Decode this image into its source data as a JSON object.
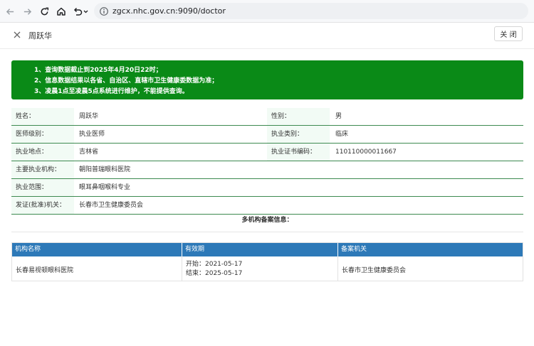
{
  "browser": {
    "url": "zgcx.nhc.gov.cn:9090/doctor"
  },
  "dialog": {
    "title": "周跃华",
    "close_label": "关 闭"
  },
  "notice": {
    "lines": [
      "1、查询数据截止到2025年4月20日22时；",
      "2、信息数据结果以各省、自治区、直辖市卫生健康委数据为准；",
      "3、凌晨1点至凌晨5点系统进行维护，不能提供查询。"
    ]
  },
  "info": {
    "rows": [
      {
        "label": "姓名：",
        "value": "周跃华",
        "label2": "性别：",
        "value2": "男"
      },
      {
        "label": "医师级别：",
        "value": "执业医师",
        "label2": "执业类别：",
        "value2": "临床"
      },
      {
        "label": "执业地点：",
        "value": "吉林省",
        "label2": "执业证书编码：",
        "value2": "110110000011667"
      },
      {
        "label": "主要执业机构：",
        "value": "朝阳普瑞眼科医院",
        "label2": "",
        "value2": ""
      },
      {
        "label": "执业范围：",
        "value": "眼耳鼻咽喉科专业",
        "label2": "",
        "value2": ""
      },
      {
        "label": "发证(批准)机关：",
        "value": "长春市卫生健康委员会",
        "label2": "",
        "value2": ""
      }
    ]
  },
  "agencies": {
    "title": "多机构备案信息：",
    "headers": [
      "机构名称",
      "有效期",
      "备案机关"
    ],
    "rows": [
      {
        "name": "长春易视顿眼科医院",
        "start": "开始：2021-05-17",
        "end": "结束：2025-05-17",
        "authority": "长春市卫生健康委员会"
      }
    ]
  }
}
